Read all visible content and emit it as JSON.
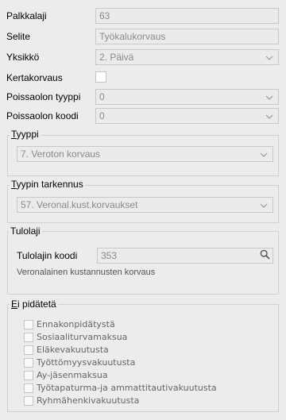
{
  "fields": {
    "palkkalaji": {
      "label": "Palkkalaji",
      "value": "63"
    },
    "selite": {
      "label": "Selite",
      "value": "Työkalukorvaus"
    },
    "yksikko": {
      "label": "Yksikkö",
      "value": "2. Päivä"
    },
    "kertakorvaus": {
      "label": "Kertakorvaus"
    },
    "poissaolon_tyyppi": {
      "label": "Poissaolon tyyppi",
      "value": "0"
    },
    "poissaolon_koodi": {
      "label": "Poissaolon koodi",
      "value": "0"
    }
  },
  "tyyppi": {
    "legend_first": "T",
    "legend_rest": "yyppi",
    "value": "7. Veroton korvaus"
  },
  "tyypin_tarkennus": {
    "legend_first": "T",
    "legend_rest": "yypin tarkennus",
    "value": "57. Veronal.kust.korvaukset"
  },
  "tulolaji": {
    "legend": "Tulolaji",
    "code_label": "Tulolajin koodi",
    "code_value": "353",
    "description": "Veronalainen kustannusten korvaus"
  },
  "ei_pidateta": {
    "legend_first": "E",
    "legend_rest": "i pidätetä",
    "items": [
      "Ennakonpidätystä",
      "Sosiaaliturvamaksua",
      "Eläkevakuutusta",
      "Työttömyysvakuutusta",
      "Ay-jäsenmaksua",
      "Työtapaturma-ja ammattitautivakuutusta",
      "Ryhmähenkivakuutusta"
    ]
  }
}
